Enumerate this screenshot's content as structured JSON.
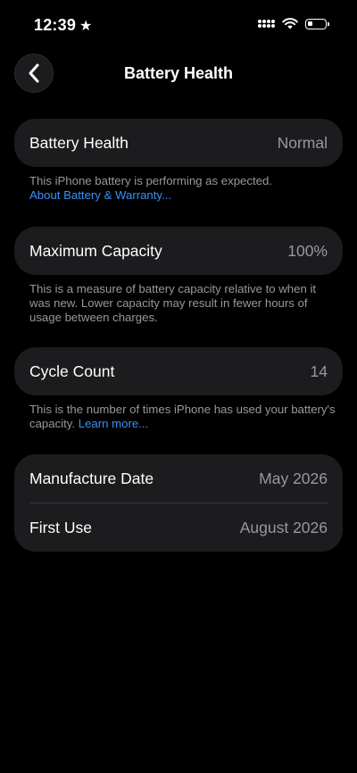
{
  "status": {
    "time": "12:39",
    "star_glyph": "★"
  },
  "nav": {
    "title": "Battery Health",
    "back_icon": "chevron-left-icon"
  },
  "health": {
    "label": "Battery Health",
    "value": "Normal",
    "note": "This iPhone battery is performing as expected.",
    "link": "About Battery & Warranty..."
  },
  "capacity": {
    "label": "Maximum Capacity",
    "value": "100%",
    "note": "This is a measure of battery capacity relative to when it was new. Lower capacity may result in fewer hours of usage between charges."
  },
  "cycles": {
    "label": "Cycle Count",
    "value": "14",
    "note": "This is the number of times iPhone has used your battery's capacity.",
    "link": "Learn more..."
  },
  "dates": {
    "manufacture_label": "Manufacture Date",
    "manufacture_value": "May 2026",
    "first_use_label": "First Use",
    "first_use_value": "August 2026"
  },
  "colors": {
    "background": "#000000",
    "card": "#1c1c1e",
    "secondary_text": "#98989e",
    "link": "#3a91f5"
  }
}
